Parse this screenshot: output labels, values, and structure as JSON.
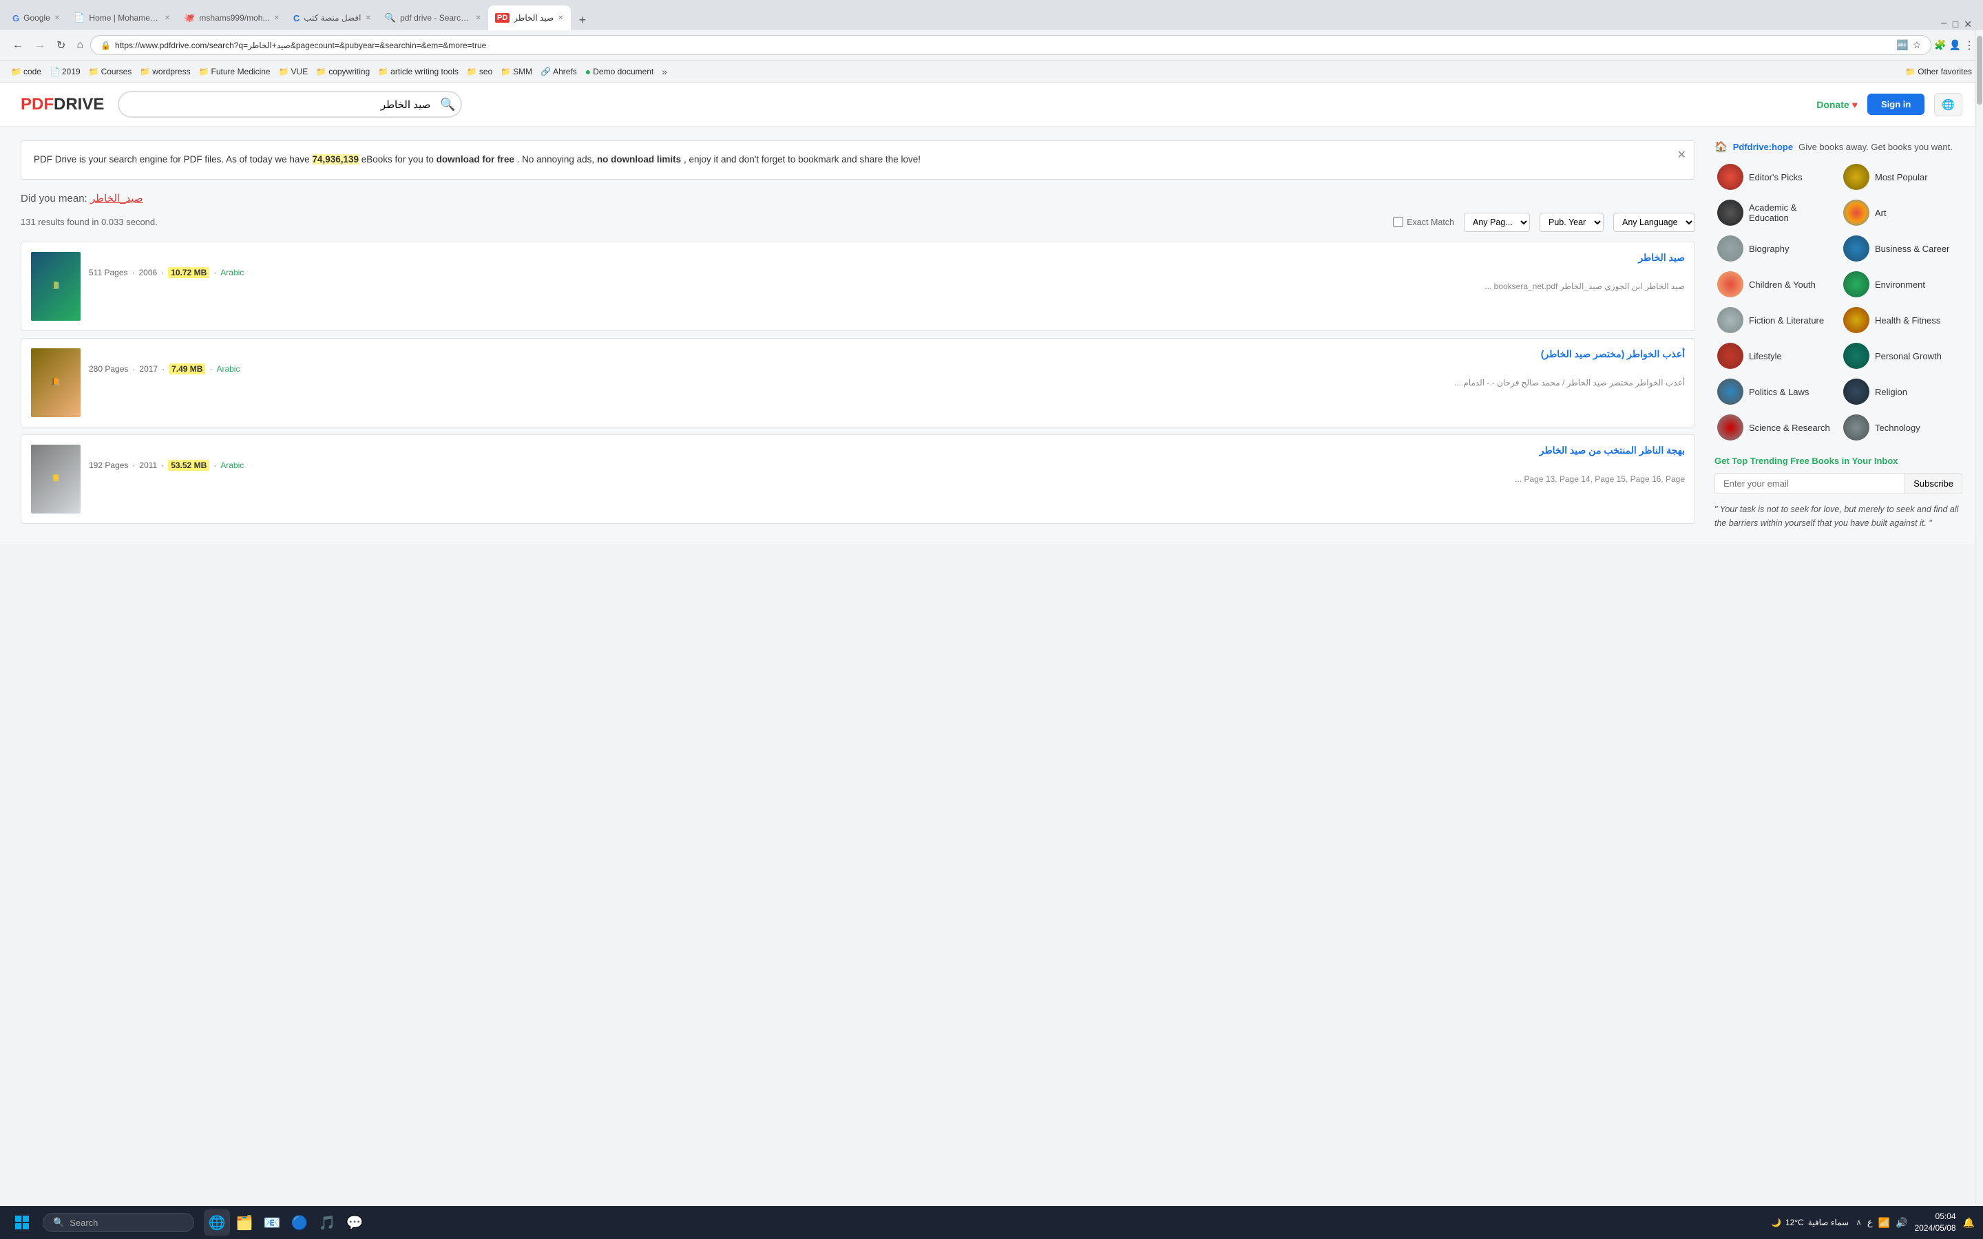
{
  "browser": {
    "tabs": [
      {
        "label": "Google",
        "favicon": "G",
        "active": false
      },
      {
        "label": "Home | Mohamed...",
        "favicon": "📄",
        "active": false
      },
      {
        "label": "mshams999/moh...",
        "favicon": "🐙",
        "active": false
      },
      {
        "label": "افضل منصة كتب",
        "favicon": "C",
        "active": false
      },
      {
        "label": "pdf drive - Search...",
        "favicon": "🔍",
        "active": false
      },
      {
        "label": "صيد الخاطر",
        "favicon": "PD",
        "active": true
      }
    ],
    "address": "https://www.pdfdrive.com/search?q=صيد+الخاطر&pagecount=&pubyear=&searchin=&em=&more=true",
    "bookmarks": [
      {
        "label": "code",
        "icon": "📁"
      },
      {
        "label": "2019",
        "icon": "📄"
      },
      {
        "label": "Courses",
        "icon": "📁"
      },
      {
        "label": "wordpress",
        "icon": "📁"
      },
      {
        "label": "Future Medicine",
        "icon": "📁"
      },
      {
        "label": "VUE",
        "icon": "📁"
      },
      {
        "label": "copywriting",
        "icon": "📁"
      },
      {
        "label": "article writing tools",
        "icon": "📁"
      },
      {
        "label": "seo",
        "icon": "📁"
      },
      {
        "label": "SMM",
        "icon": "📁"
      },
      {
        "label": "Ahrefs",
        "icon": "🔗"
      },
      {
        "label": "Demo document",
        "icon": "🟢"
      },
      {
        "label": "Other favorites",
        "icon": "📁"
      }
    ]
  },
  "site": {
    "logo_pdf": "PDF",
    "logo_drive": "DRIVE",
    "search_placeholder": "صيد الخاطر",
    "search_value": "صيد الخاطر",
    "donate_label": "Donate",
    "signin_label": "Sign in"
  },
  "banner": {
    "text_before": "PDF Drive is your search engine for PDF files. As of today we have ",
    "highlight": "74,936,139",
    "text_after": " eBooks for you to ",
    "bold1": "download for free",
    "text2": ". No annoying ads, ",
    "bold2": "no download limits",
    "text3": ", enjoy it and don't forget to bookmark and share the love!"
  },
  "search": {
    "did_you_mean_label": "Did you mean:",
    "did_you_mean_link": "صيد_الخاطر",
    "results_text": "131 results found in 0.033 second.",
    "exact_match_label": "Exact Match",
    "filter_pages": "Any Pag...",
    "filter_year": "Pub. Year",
    "filter_language": "Any Language"
  },
  "results": [
    {
      "title": "صيد الخاطر",
      "pages": "511 Pages",
      "year": "2006",
      "size": "10.72 MB",
      "lang": "Arabic",
      "desc": "صيد الخاطر ابن الجوزي صيد_الخاطر booksera_net.pdf  ...",
      "cover_class": "cover-1"
    },
    {
      "title": "أعذب الخواطر (مختصر صيد الخاطر)",
      "pages": "280 Pages",
      "year": "2017",
      "size": "7.49 MB",
      "lang": "Arabic",
      "desc": "أعذب الخواطر مختصر صيد الخاطر / محمد صالح فرحان -.- الدمام  ...",
      "cover_class": "cover-2"
    },
    {
      "title": "بهجة الناظر المنتخب من صيد الخاطر",
      "pages": "192 Pages",
      "year": "2011",
      "size": "53.52 MB",
      "lang": "Arabic",
      "desc": "Page 13, Page 14, Page 15, Page 16, Page ...",
      "cover_class": "cover-3"
    }
  ],
  "sidebar": {
    "hope_label": "Pdfdrive:hope",
    "hope_text": "Give books away. Get books you want.",
    "categories": [
      {
        "label": "Editor's Picks",
        "icon_class": "cat-editors",
        "icon": "📚"
      },
      {
        "label": "Most Popular",
        "icon_class": "cat-popular",
        "icon": "⭐"
      },
      {
        "label": "Academic & Education",
        "icon_class": "cat-academic",
        "icon": "🎓"
      },
      {
        "label": "Art",
        "icon_class": "cat-art",
        "icon": "🎨"
      },
      {
        "label": "Biography",
        "icon_class": "cat-biography",
        "icon": "👤"
      },
      {
        "label": "Business & Career",
        "icon_class": "cat-business",
        "icon": "💼"
      },
      {
        "label": "Children & Youth",
        "icon_class": "cat-children",
        "icon": "🧒"
      },
      {
        "label": "Environment",
        "icon_class": "cat-environment",
        "icon": "🌿"
      },
      {
        "label": "Fiction & Literature",
        "icon_class": "cat-fiction",
        "icon": "📖"
      },
      {
        "label": "Health & Fitness",
        "icon_class": "cat-health",
        "icon": "💪"
      },
      {
        "label": "Lifestyle",
        "icon_class": "cat-lifestyle",
        "icon": "🌸"
      },
      {
        "label": "Personal Growth",
        "icon_class": "cat-personal",
        "icon": "🌱"
      },
      {
        "label": "Politics & Laws",
        "icon_class": "cat-politics",
        "icon": "⚖️"
      },
      {
        "label": "Religion",
        "icon_class": "cat-religion",
        "icon": "✝️"
      },
      {
        "label": "Science & Research",
        "icon_class": "cat-science",
        "icon": "🔬"
      },
      {
        "label": "Technology",
        "icon_class": "cat-technology",
        "icon": "💻"
      }
    ],
    "newsletter_title": "Get Top Trending Free Books in Your Inbox",
    "email_placeholder": "Enter your email",
    "subscribe_label": "Subscribe",
    "quote": "\" Your task is not to seek for love, but merely to seek and find all the barriers within yourself that you have built against it. \""
  },
  "taskbar": {
    "search_placeholder": "Search",
    "time": "05:04",
    "date": "2024/05/08",
    "weather_temp": "12°C",
    "weather_desc": "سماء صافية"
  }
}
